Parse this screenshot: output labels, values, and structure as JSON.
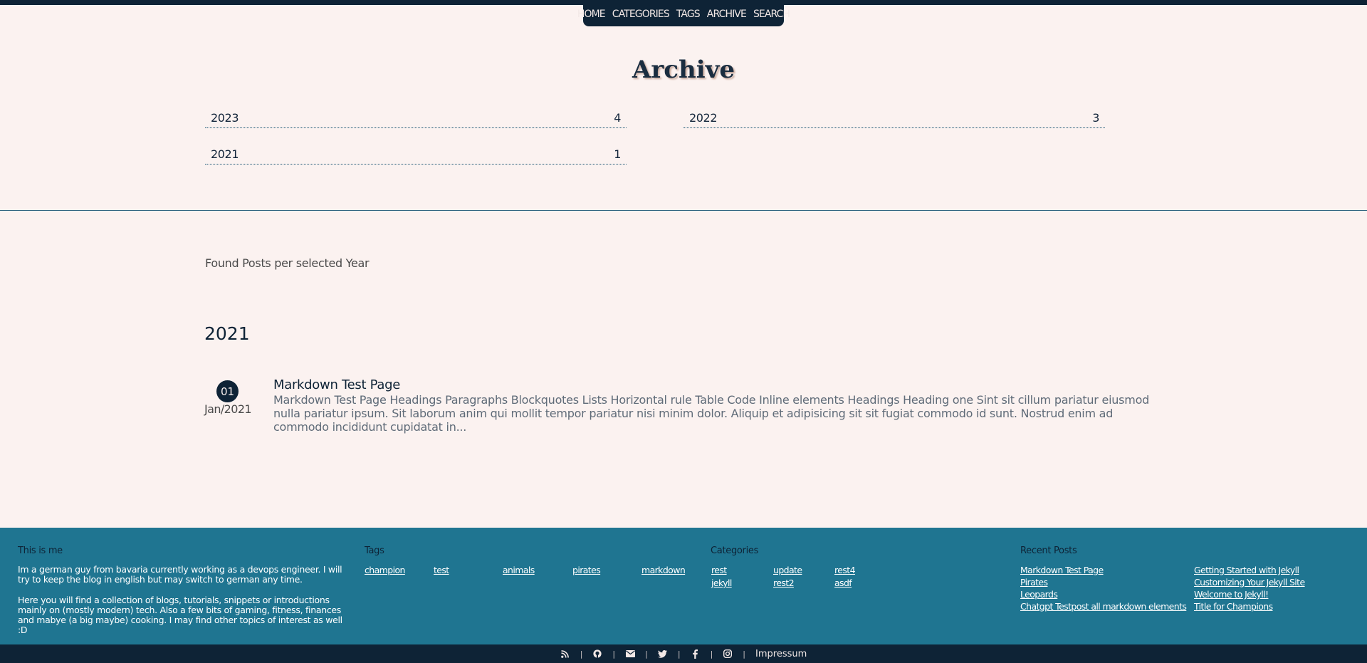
{
  "nav": {
    "items": [
      "HOME",
      "CATEGORIES",
      "TAGS",
      "ARCHIVE",
      "SEARCH"
    ]
  },
  "page_title": "Archive",
  "years": [
    {
      "year": "2023",
      "count": "4"
    },
    {
      "year": "2022",
      "count": "3"
    },
    {
      "year": "2021",
      "count": "1"
    }
  ],
  "found_label": "Found Posts per selected Year",
  "selected_year": "2021",
  "posts": [
    {
      "day": "01",
      "month_year": "Jan/2021",
      "title": "Markdown Test Page",
      "excerpt": "Markdown Test Page Headings Paragraphs Blockquotes Lists Horizontal rule Table Code Inline elements Headings Heading one Sint sit cillum pariatur eiusmod nulla pariatur ipsum. Sit laborum anim qui mollit tempor pariatur nisi minim dolor. Aliquip et adipisicing sit sit fugiat commodo id sunt. Nostrud enim ad commodo incididunt cupidatat in..."
    }
  ],
  "footer": {
    "about": {
      "heading": "This is me",
      "p1": "Im a german guy from bavaria currently working as a devops engineer. I will try to keep the blog in english but may switch to german any time.",
      "p2": "Here you will find a collection of blogs, tutorials, snippets or introductions mainly on (mostly modern) tech. Also a few bits of gaming, fitness, finances and mabye (a big maybe) cooking. I may find other topics of interest as well :D"
    },
    "tags": {
      "heading": "Tags",
      "items": [
        "champion",
        "test",
        "animals",
        "pirates",
        "markdown"
      ]
    },
    "categories": {
      "heading": "Categories",
      "items": [
        "rest",
        "update",
        "rest4",
        "jekyll",
        "rest2",
        "asdf"
      ]
    },
    "recent": {
      "heading": "Recent Posts",
      "items": [
        "Markdown Test Page",
        "Pirates",
        "Leopards",
        "Chatgpt Testpost all markdown elements",
        "Getting Started with Jekyll",
        "Customizing Your Jekyll Site",
        "Welcome to Jekyll!",
        "Title for Champions"
      ]
    }
  },
  "bottombar": {
    "icons": [
      "rss-icon",
      "github-icon",
      "mail-icon",
      "twitter-icon",
      "facebook-icon",
      "instagram-icon"
    ],
    "separator": "|",
    "impressum": "Impressum"
  },
  "colors": {
    "background": "#fbf2f0",
    "navy": "#0e2336",
    "footer": "#1f7591"
  }
}
